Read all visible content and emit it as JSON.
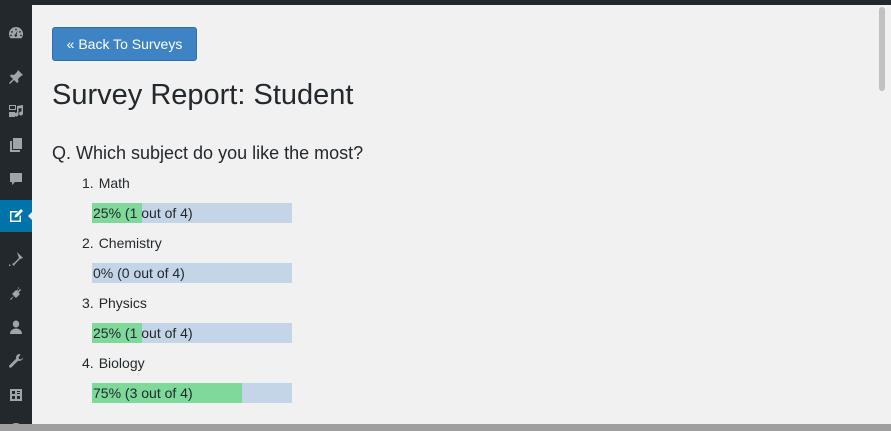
{
  "sidebar": {
    "items": [
      {
        "icon": "dashboard-icon"
      },
      {
        "icon": "pin-icon"
      },
      {
        "icon": "media-icon"
      },
      {
        "icon": "pages-icon"
      },
      {
        "icon": "comments-icon"
      },
      {
        "icon": "survey-icon",
        "active": true
      },
      {
        "icon": "appearance-icon"
      },
      {
        "icon": "plugins-icon"
      },
      {
        "icon": "users-icon"
      },
      {
        "icon": "tools-icon"
      },
      {
        "icon": "settings-icon"
      }
    ]
  },
  "back_button": {
    "label": "« Back To Surveys"
  },
  "page_title": "Survey Report: Student",
  "question": {
    "text": "Q. Which subject do you like the most?",
    "answers": [
      {
        "number": "1.",
        "label": "Math",
        "percent_text": "25% (1 out of 4)",
        "fraction": 0.25
      },
      {
        "number": "2.",
        "label": "Chemistry",
        "percent_text": "0% (0 out of 4)",
        "fraction": 0.0
      },
      {
        "number": "3.",
        "label": "Physics",
        "percent_text": "25% (1 out of 4)",
        "fraction": 0.25
      },
      {
        "number": "4.",
        "label": "Biology",
        "percent_text": "75% (3 out of 4)",
        "fraction": 0.75
      }
    ]
  },
  "colors": {
    "admin_bar": "#23282d",
    "active_menu": "#0073aa",
    "button": "#3e84c5",
    "bar_track": "#c5d5e8",
    "bar_fill": "#7ed99a"
  }
}
